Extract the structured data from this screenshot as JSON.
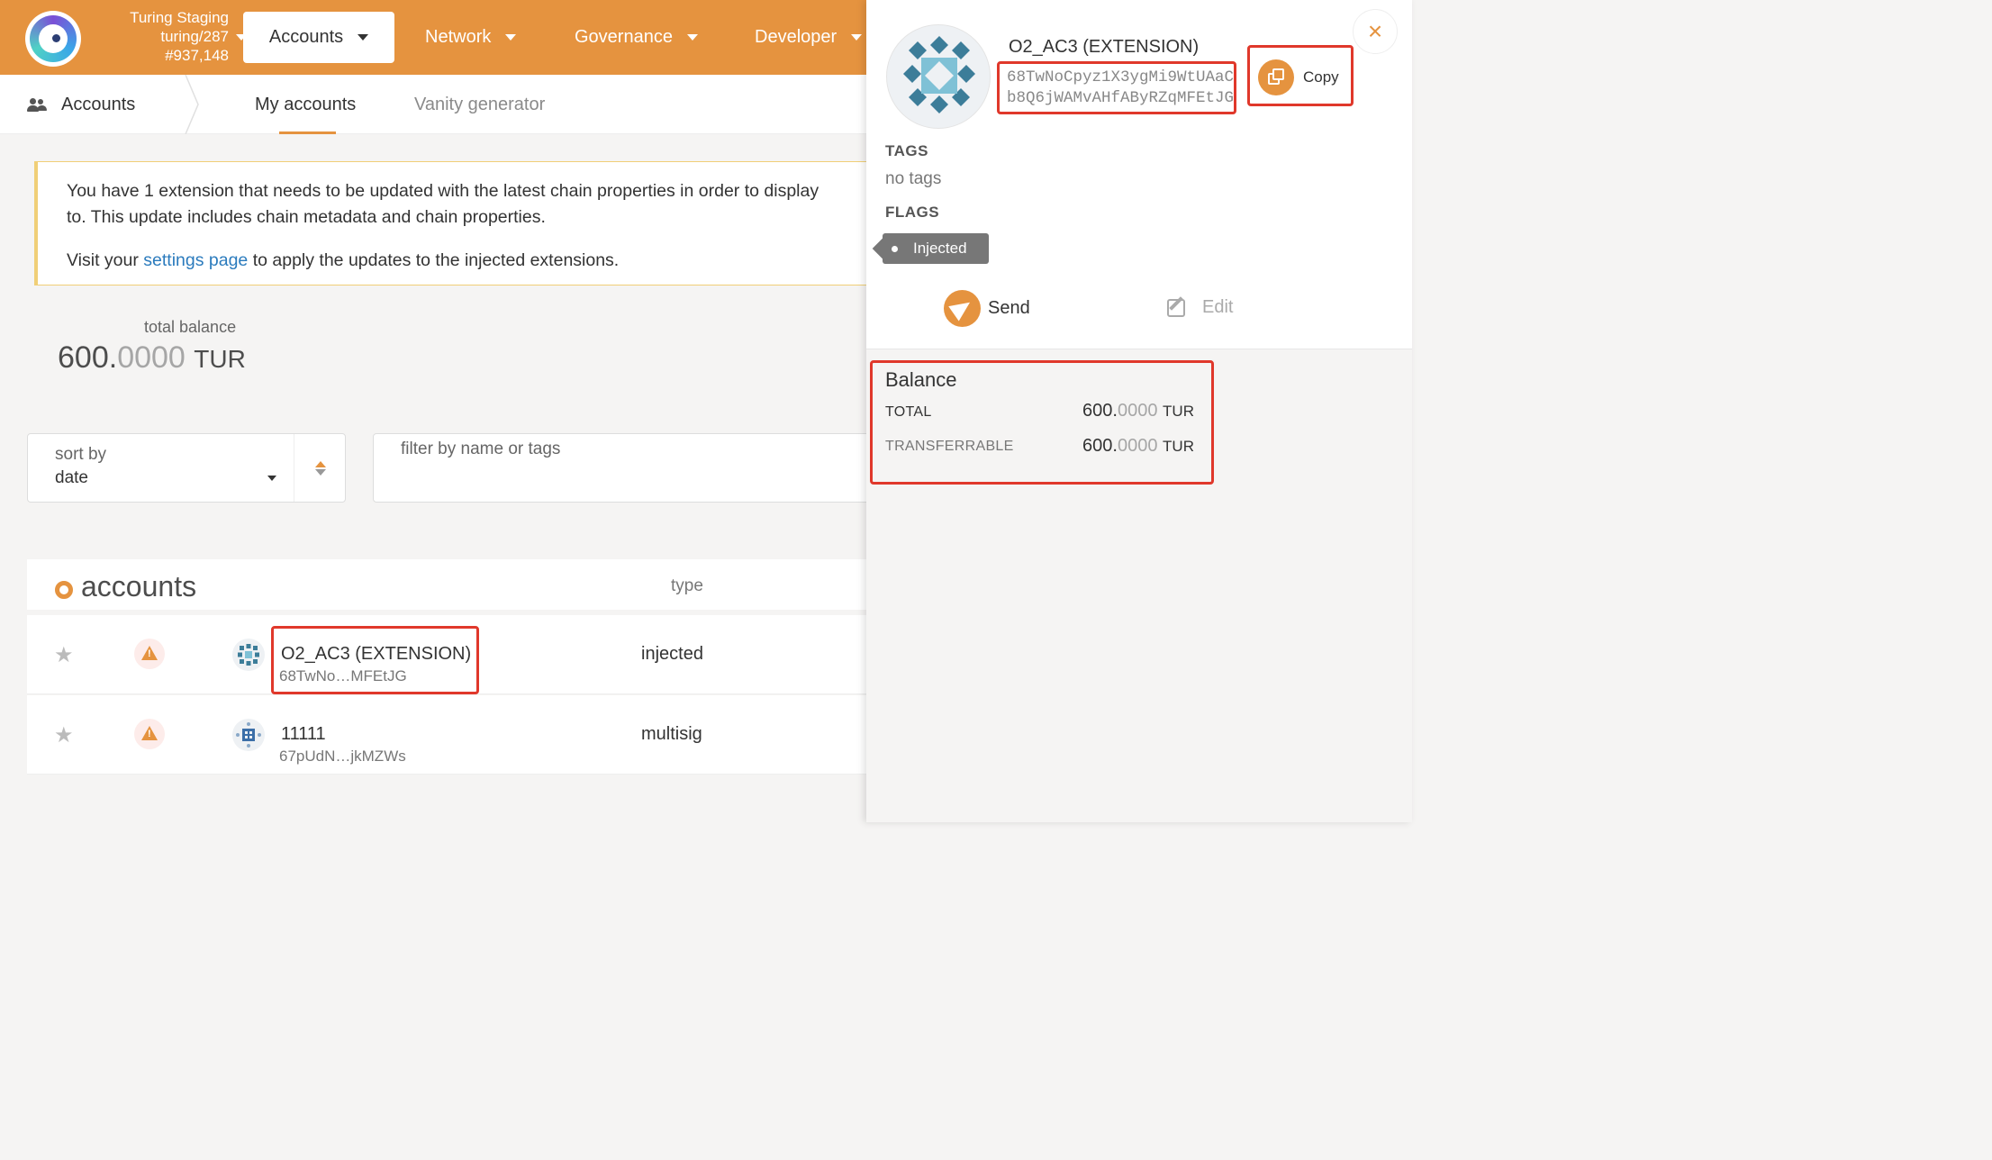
{
  "header": {
    "chain_name": "Turing Staging",
    "chain_runtime": "turing/287",
    "chain_block": "#937,148",
    "nav": [
      {
        "label": "Accounts"
      },
      {
        "label": "Network"
      },
      {
        "label": "Governance"
      },
      {
        "label": "Developer"
      }
    ],
    "accent_color": "#e5933f"
  },
  "subnav": {
    "title": "Accounts",
    "tabs": [
      {
        "label": "My accounts",
        "active": true
      },
      {
        "label": "Vanity generator",
        "active": false
      }
    ]
  },
  "notice": {
    "line1": "You have 1 extension that needs to be updated with the latest chain properties in order to display",
    "line2": "to. This update includes chain metadata and chain properties.",
    "line3_pre": "Visit your ",
    "line3_link": "settings page",
    "line3_post": " to apply the updates to the injected extensions."
  },
  "total_balance": {
    "label": "total balance",
    "integer": "600.",
    "fraction": "0000",
    "unit": "TUR"
  },
  "sort": {
    "label": "sort by",
    "value": "date"
  },
  "filter": {
    "placeholder": "filter by name or tags"
  },
  "accounts_table": {
    "title": "accounts",
    "type_header": "type",
    "rows": [
      {
        "name": "O2_AC3 (EXTENSION)",
        "address": "68TwNo…MFEtJG",
        "type": "injected"
      },
      {
        "name": "11111",
        "address": "67pUdN…jkMZWs",
        "type": "multisig"
      }
    ]
  },
  "panel": {
    "name": "O2_AC3 (EXTENSION)",
    "address_line1": "68TwNoCpyz1X3ygMi9WtUAaC",
    "address_line2": "b8Q6jWAMvAHfAByRZqMFEtJG",
    "copy_label": "Copy",
    "close_icon": "×",
    "tags_label": "TAGS",
    "tags_value": "no tags",
    "flags_label": "FLAGS",
    "flag": "Injected",
    "send_label": "Send",
    "edit_label": "Edit",
    "balance": {
      "title": "Balance",
      "rows": [
        {
          "label": "TOTAL",
          "integer": "600.",
          "fraction": "0000",
          "unit": "TUR"
        },
        {
          "label": "TRANSFERRABLE",
          "integer": "600.",
          "fraction": "0000",
          "unit": "TUR"
        }
      ]
    }
  },
  "icons": [
    "chain-logo-icon",
    "people-icon",
    "star-icon",
    "warning-icon",
    "identicon",
    "copy-icon",
    "close-icon",
    "send-icon",
    "edit-icon",
    "sort-direction-icon"
  ]
}
